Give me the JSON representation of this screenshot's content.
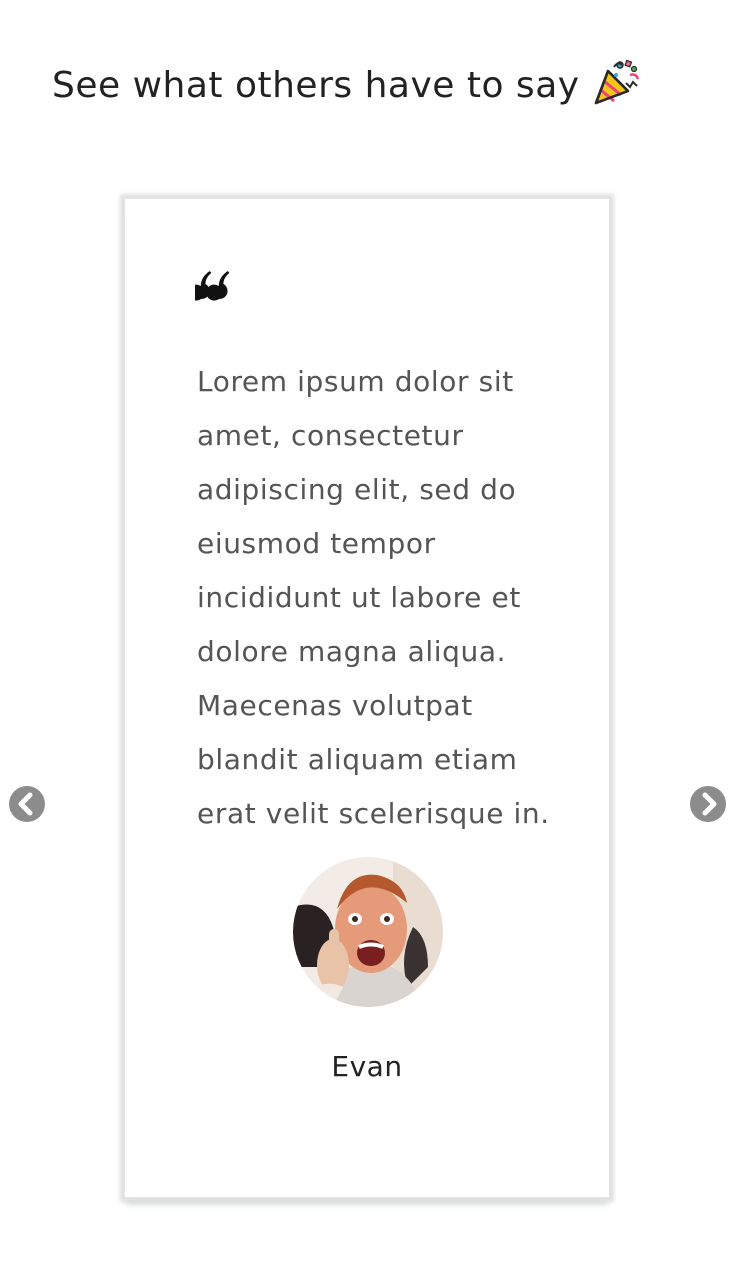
{
  "section": {
    "title": "See what others have to say",
    "title_icon": "party-popper-icon"
  },
  "testimonial": {
    "quote_icon": "quote-icon",
    "text": "Lorem ipsum dolor sit amet, consectetur adipiscing elit, sed do eiusmod tempor incididunt ut labore et dolore magna aliqua. Maecenas volutpat blandit aliquam etiam erat velit scelerisque in.",
    "author_name": "Evan",
    "avatar_alt": "Evan"
  },
  "carousel": {
    "prev_icon": "chevron-left-icon",
    "next_icon": "chevron-right-icon"
  },
  "colors": {
    "heading": "#222222",
    "body_text": "#555555",
    "nav_arrow": "#8c8c8c",
    "card_shadow": "#dfe1e1"
  }
}
